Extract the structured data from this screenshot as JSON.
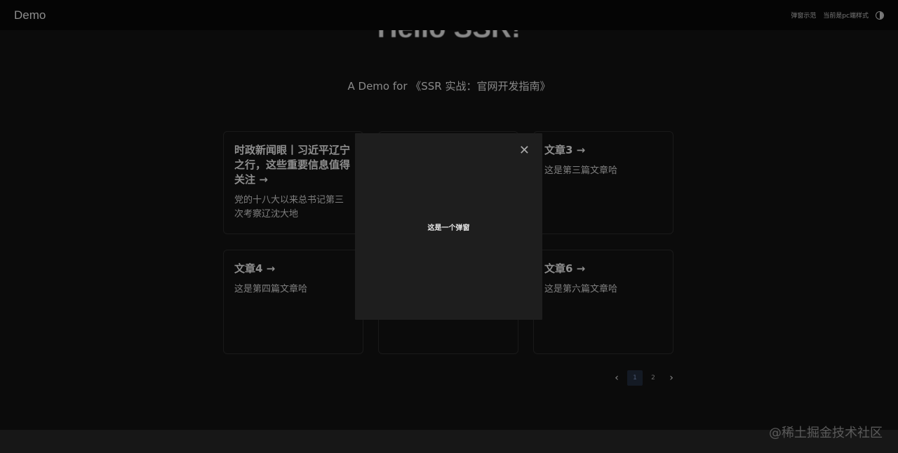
{
  "header": {
    "brand": "Demo",
    "nav": [
      "弹窗示范",
      "当前是pc端样式"
    ],
    "theme_icon": "theme-toggle-icon"
  },
  "hero": {
    "title": "Hello SSR!",
    "subtitle": "A Demo for 《SSR 实战：官网开发指南》"
  },
  "cards": [
    {
      "title": "时政新闻眼丨习近平辽宁之行，这些重要信息值得关注 →",
      "desc": "党的十八大以来总书记第三次考察辽沈大地"
    },
    {
      "title": "",
      "desc": ""
    },
    {
      "title": "文章3 →",
      "desc": "这是第三篇文章哈"
    },
    {
      "title": "文章4 →",
      "desc": "这是第四篇文章哈"
    },
    {
      "title": "",
      "desc": ""
    },
    {
      "title": "文章6 →",
      "desc": "这是第六篇文章哈"
    }
  ],
  "pagination": {
    "prev_icon": "chevron-left-icon",
    "pages": [
      "1",
      "2"
    ],
    "current": "1",
    "next_icon": "chevron-right-icon"
  },
  "modal": {
    "close_label": "✕",
    "body": "这是一个弹窗"
  },
  "watermark": "@稀土掘金技术社区"
}
